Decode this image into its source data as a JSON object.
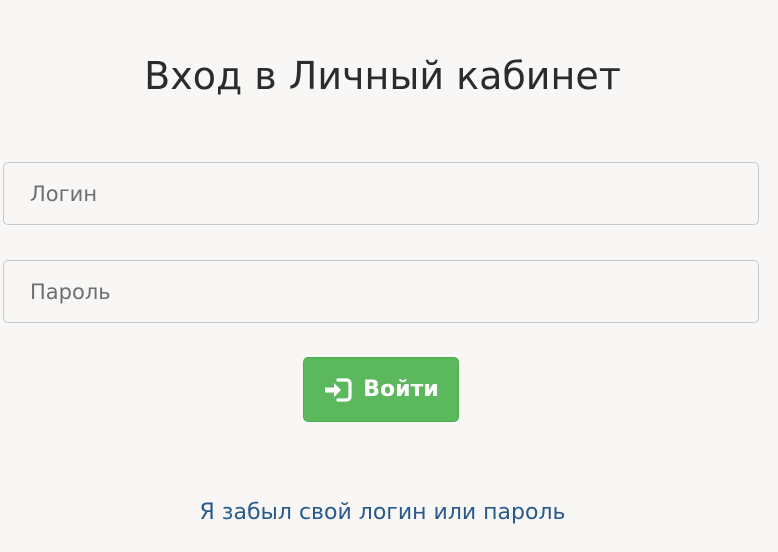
{
  "page": {
    "title": "Вход в Личный кабинет"
  },
  "form": {
    "login_placeholder": "Логин",
    "password_placeholder": "Пароль",
    "submit_label": "Войти",
    "submit_icon": "sign-in-icon",
    "forgot_link": "Я забыл свой логин или пароль"
  },
  "colors": {
    "background": "#f8f7f6",
    "button": "#5cb85c",
    "link": "#2a5a8c"
  }
}
